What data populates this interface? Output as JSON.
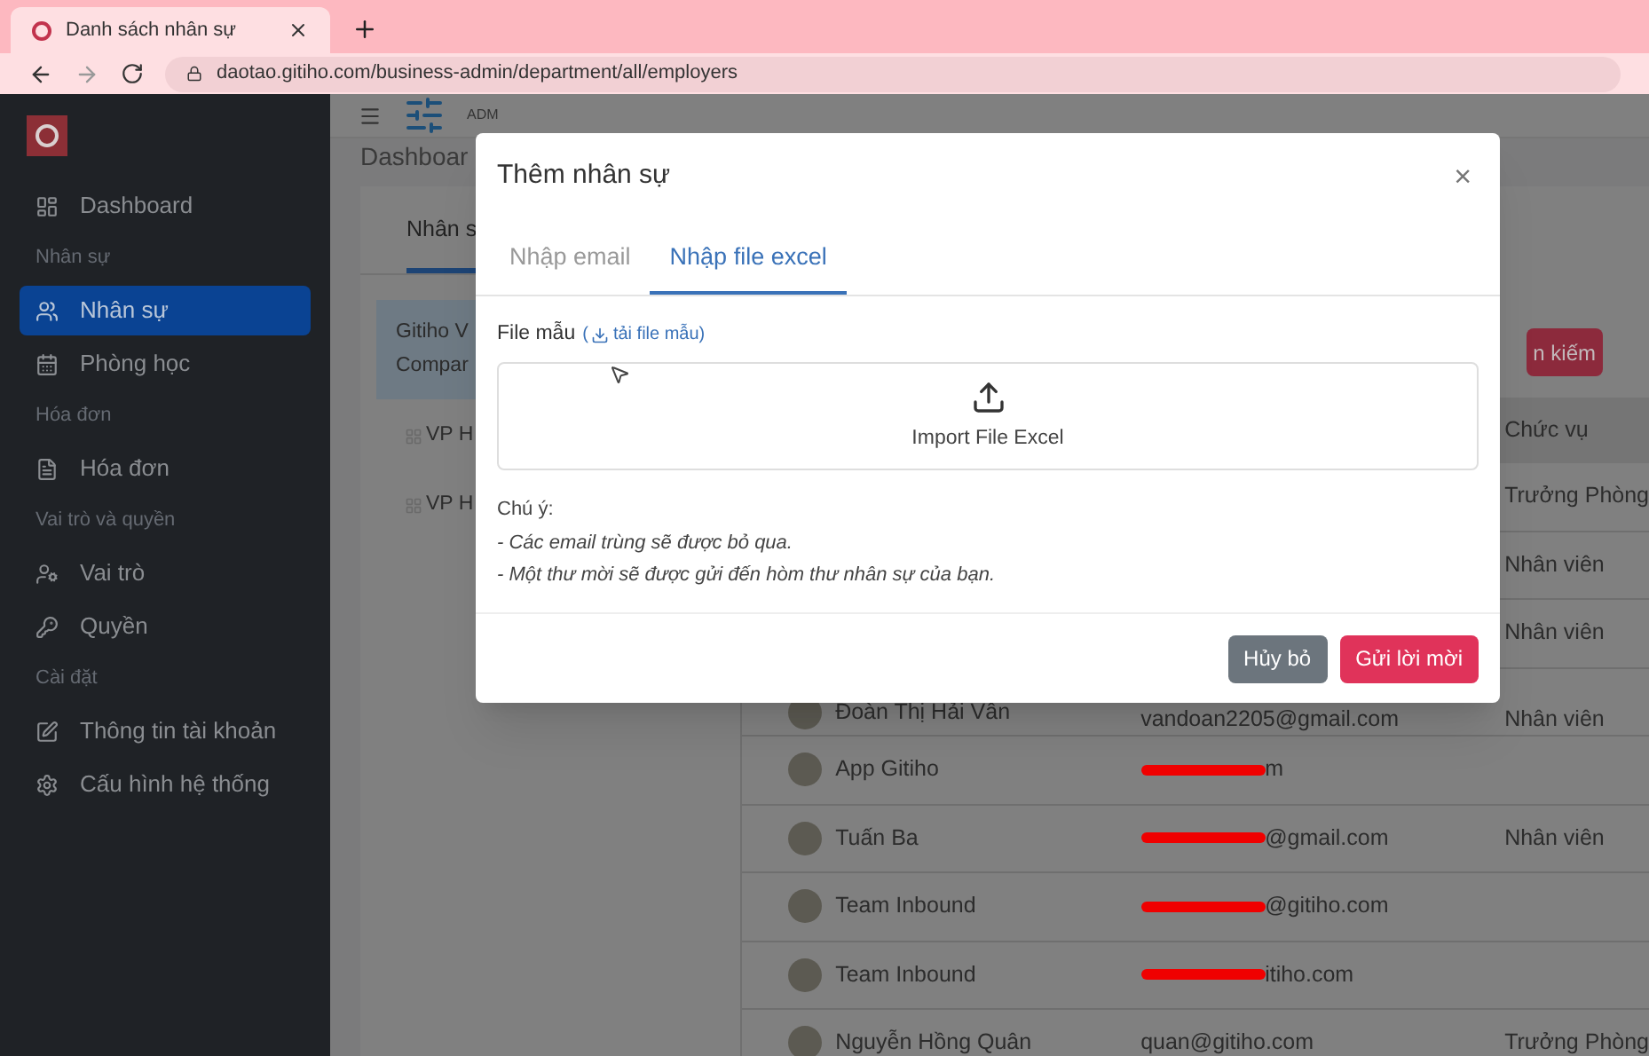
{
  "browser": {
    "tab_title": "Danh sách nhân sự",
    "url": "daotao.gitiho.com/business-admin/department/all/employers"
  },
  "sidebar": {
    "items": [
      {
        "kind": "item",
        "label": "Dashboard",
        "selected": false
      },
      {
        "kind": "section",
        "label": "Nhân sự"
      },
      {
        "kind": "item",
        "label": "Nhân sự",
        "selected": true
      },
      {
        "kind": "item",
        "label": "Phòng học",
        "selected": false
      },
      {
        "kind": "section",
        "label": "Hóa đơn"
      },
      {
        "kind": "item",
        "label": "Hóa đơn",
        "selected": false
      },
      {
        "kind": "section",
        "label": "Vai trò và quyền"
      },
      {
        "kind": "item",
        "label": "Vai trò",
        "selected": false
      },
      {
        "kind": "item",
        "label": "Quyền",
        "selected": false
      },
      {
        "kind": "section",
        "label": "Cài đặt"
      },
      {
        "kind": "item",
        "label": "Thông tin tài khoản",
        "selected": false
      },
      {
        "kind": "item",
        "label": "Cấu hình hệ thống",
        "selected": false
      }
    ]
  },
  "header": {
    "label": "ADM"
  },
  "breadcrumb": "Dashboar",
  "left_panel": {
    "tab": "Nhân s",
    "tree": [
      {
        "lines": [
          "Gitiho V",
          "Compar"
        ],
        "selected": true
      },
      {
        "lines": [
          "VP H"
        ],
        "selected": false
      },
      {
        "lines": [
          "VP H"
        ],
        "selected": false
      }
    ]
  },
  "search_button": "n kiếm",
  "table": {
    "columns": [
      "Chức vụ"
    ],
    "rows": [
      {
        "role": "Trưởng Phòng"
      },
      {
        "role": "Nhân viên"
      },
      {
        "role": "Nhân viên"
      },
      {
        "name": "Đoàn Thị Hải Vân",
        "email": "vandoan2205@gmail.com",
        "redacted": false,
        "role": "Nhân viên"
      },
      {
        "name": "App Gitiho",
        "email": "m",
        "redacted": true
      },
      {
        "name": "Tuấn Ba",
        "email": "@gmail.com",
        "redacted": true,
        "role": "Nhân viên"
      },
      {
        "name": "Team Inbound",
        "email": "@gitiho.com",
        "redacted": true
      },
      {
        "name": "Team Inbound",
        "email": "itiho.com",
        "redacted": true
      },
      {
        "name": "Nguyễn Hồng Quân",
        "email": "quan@gitiho.com",
        "redacted": false,
        "role": "Trưởng Phòng"
      }
    ]
  },
  "modal": {
    "title": "Thêm nhân sự",
    "close": "×",
    "tabs": [
      {
        "label": "Nhập email",
        "selected": false
      },
      {
        "label": "Nhập file excel",
        "selected": true
      }
    ],
    "template_label": "File mẫu",
    "template_link": {
      "prefix": "(",
      "label": "tải file mẫu)"
    },
    "upload_label": "Import File Excel",
    "note_title": "Chú ý:",
    "notes": [
      "- Các email trùng sẽ được bỏ qua.",
      "- Một thư mời sẽ được gửi đến hòm thư nhân sự của bạn."
    ],
    "buttons": [
      {
        "label": "Hủy bỏ",
        "kind": "secondary"
      },
      {
        "label": "Gửi lời mời",
        "kind": "primary"
      }
    ]
  }
}
